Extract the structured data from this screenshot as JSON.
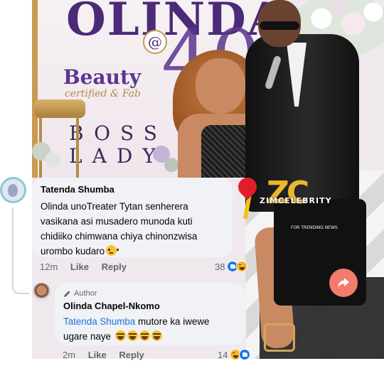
{
  "photo": {
    "backdrop_title": "OLINDA",
    "backdrop_at": "@",
    "backdrop_number": "40",
    "backdrop_beauty": "Beauty",
    "backdrop_certified": "certified & Fab",
    "backdrop_boss_line1": "BOSS",
    "backdrop_boss_line2": "LADY",
    "watermark_letters": "ZC",
    "watermark_brand": "ZIMCELEBRITY",
    "watermark_tagline": "FOR TRENDING NEWS"
  },
  "comment": {
    "author": "Tatenda Shumba",
    "text": "Olinda unoTreater Tytan senherera vasikana asi musadero munoda kuti chidiiko chimwana chiya chinonzwisa urombo kudaro",
    "emoji": "flushed-face",
    "time": "12m",
    "like_label": "Like",
    "reply_label": "Reply",
    "reaction_count": "38",
    "reactions": [
      "like",
      "haha"
    ]
  },
  "reply": {
    "badge": "Author",
    "author": "Olinda Chapel-Nkomo",
    "mention": "Tatenda Shumba",
    "text_line1": " mutore ka iwewe",
    "text_line2": "ugare naye",
    "emojis": [
      "laughing-face",
      "laughing-face",
      "laughing-face",
      "laughing-face"
    ],
    "time": "2m",
    "like_label": "Like",
    "reply_label": "Reply",
    "reaction_count": "14",
    "reactions": [
      "haha",
      "like"
    ]
  },
  "colors": {
    "bubble_bg": "#f0f2f5",
    "meta_text": "#65676b",
    "mention": "#216fdb",
    "like_blue": "#1877f2",
    "haha_yellow": "#f7b125"
  }
}
